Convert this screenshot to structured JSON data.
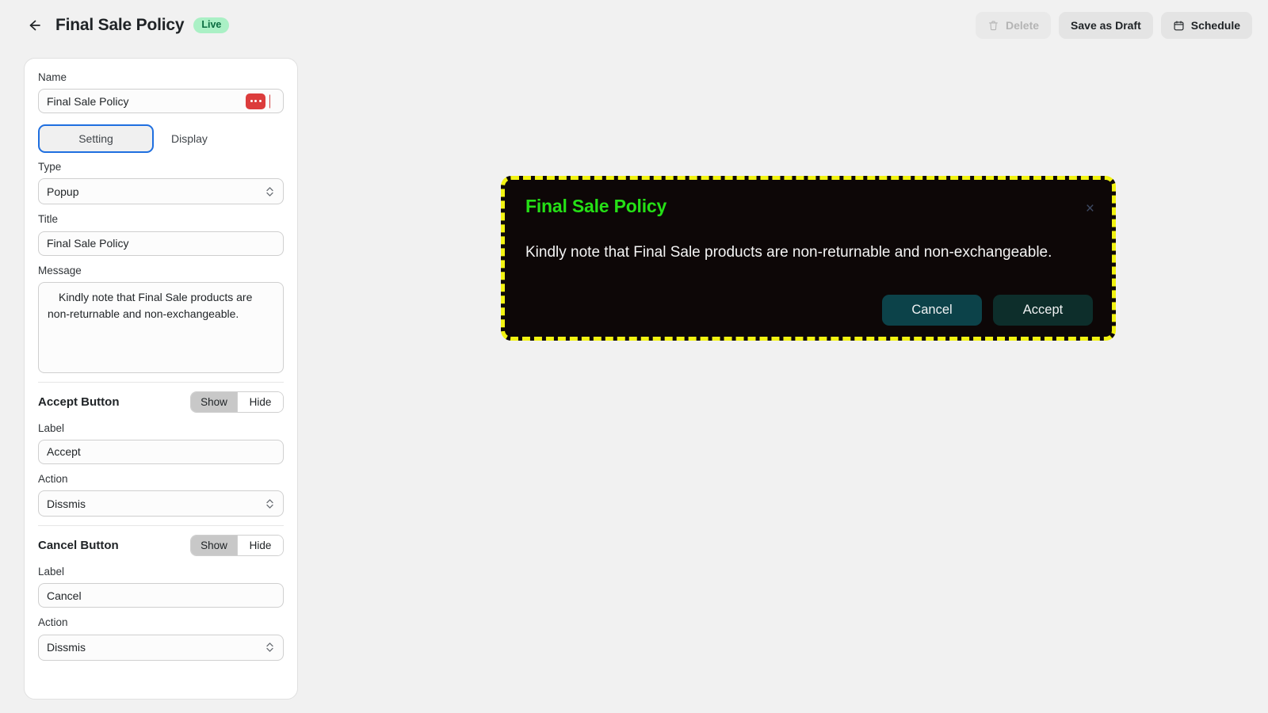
{
  "header": {
    "back_icon": "arrow-left-icon",
    "title": "Final Sale Policy",
    "status_badge": "Live",
    "status_badge_bg": "#aaf0c5",
    "status_badge_fg": "#0b6b40",
    "actions": {
      "delete_label": "Delete",
      "delete_icon": "trash-icon",
      "delete_disabled": true,
      "save_draft_label": "Save as Draft",
      "schedule_label": "Schedule",
      "schedule_icon": "calendar-icon"
    }
  },
  "panel": {
    "name": {
      "label": "Name",
      "value": "Final Sale Policy",
      "more_icon": "ellipsis-icon",
      "more_icon_bg": "#dc3c3c"
    },
    "tabs": [
      {
        "label": "Setting",
        "active": true
      },
      {
        "label": "Display",
        "active": false
      }
    ],
    "type": {
      "label": "Type",
      "value": "Popup",
      "chevron_icon": "chevron-updown-icon"
    },
    "title": {
      "label": "Title",
      "value": "Final Sale Policy"
    },
    "message": {
      "label": "Message",
      "value": "Kindly note that Final Sale products are non-returnable and non-exchangeable."
    },
    "accept_button": {
      "section_title": "Accept Button",
      "toggle": {
        "show": "Show",
        "hide": "Hide",
        "selected": "Show"
      },
      "label_label": "Label",
      "label_value": "Accept",
      "action_label": "Action",
      "action_value": "Dissmis"
    },
    "cancel_button": {
      "section_title": "Cancel Button",
      "toggle": {
        "show": "Show",
        "hide": "Hide",
        "selected": "Show"
      },
      "label_label": "Label",
      "label_value": "Cancel",
      "action_label": "Action",
      "action_value": "Dissmis"
    }
  },
  "preview": {
    "title": "Final Sale Policy",
    "title_color": "#25e016",
    "message": "Kindly note that Final Sale products are non-returnable and non-exchangeable.",
    "close_icon": "close-icon",
    "close_label": "×",
    "background": "#0d0707",
    "border_color": "#f2f312",
    "cancel_label": "Cancel",
    "accept_label": "Accept"
  }
}
